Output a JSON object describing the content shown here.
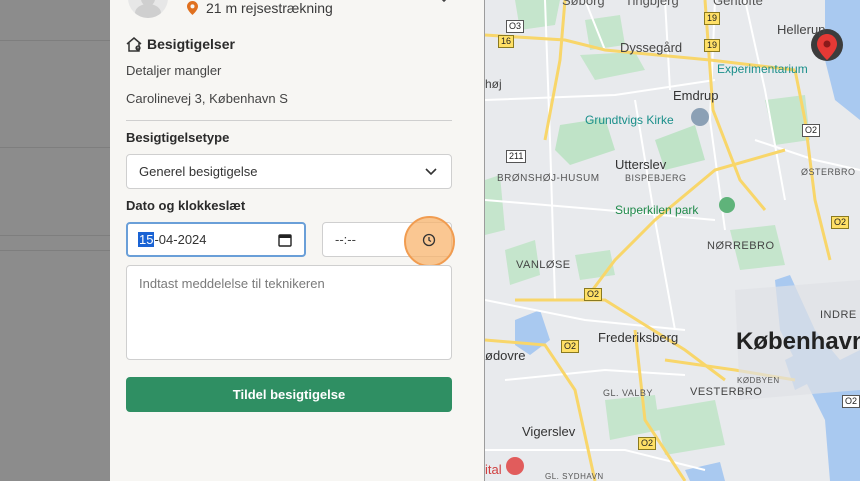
{
  "panel": {
    "distance": "21 m rejsestrækning",
    "section_title": "Besigtigelser",
    "details": "Detaljer mangler",
    "address": "Carolinevej 3, København S",
    "type_label": "Besigtigelsetype",
    "type_value": "Generel besigtigelse",
    "datetime_label": "Dato og klokkeslæt",
    "date_day": "15",
    "date_rest": "-04-2024",
    "time_value": "--:--",
    "message_placeholder": "Indtast meddelelse til teknikeren",
    "submit_label": "Tildel besigtigelse"
  },
  "map": {
    "labels": {
      "soborg": "Søborg",
      "tingbjerg": "Tingbjerg",
      "gentofte": "Gentofte",
      "hellerup": "Hellerup",
      "dyssegaard": "Dyssegård",
      "experimentarium": "Experimentarium",
      "hoj": "høj",
      "emdrup": "Emdrup",
      "grundtvigs_kirke": "Grundtvigs Kirke",
      "utterslev": "Utterslev",
      "bronshoj": "BRØNSHØJ-HUSUM",
      "bispebjerg": "BISPEBJERG",
      "osterbro": "ØSTERBRO",
      "superkilen": "Superkilen park",
      "norrebro": "NØRREBRO",
      "vanlose": "VANLØSE",
      "indre": "INDRE",
      "frederiksberg": "Frederiksberg",
      "kobenhavn": "København",
      "dovre": "ødovre",
      "kodbyen": "KØDBYEN",
      "gl_valby": "GL. VALBY",
      "vesterbro": "VESTERBRO",
      "vigerslev": "Vigerslev",
      "ital": "ital",
      "gl_sydhavn": "GL. SYDHAVN"
    },
    "shields": [
      "O3",
      "19",
      "16",
      "19",
      "O2",
      "211",
      "O2",
      "O2",
      "O2",
      "O2",
      "O2"
    ],
    "colors": {
      "land": "#e8eaed",
      "park": "#bfe3c7",
      "water": "#a9c9f0",
      "major_road": "#fde293",
      "road": "#ffffff"
    }
  }
}
